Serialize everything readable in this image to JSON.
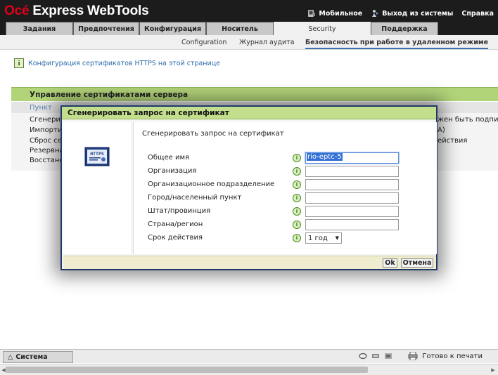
{
  "app": {
    "logo_brand": "Océ",
    "logo_rest": " Express WebTools",
    "links": [
      {
        "icon": "mobile-icon",
        "label": "Мобильное"
      },
      {
        "icon": "logout-icon",
        "label": "Выход из системы"
      },
      {
        "icon": "help-icon",
        "label": "Справка"
      }
    ]
  },
  "tabs": [
    {
      "label": "Задания"
    },
    {
      "label": "Предпочтения"
    },
    {
      "label": "Конфигурация"
    },
    {
      "label": "Носитель"
    },
    {
      "label": "Security",
      "active": true
    },
    {
      "label": "Поддержка"
    }
  ],
  "subnav": [
    {
      "label": "Configuration"
    },
    {
      "label": "Журнал аудита"
    },
    {
      "label": "Безопасность при работе в удаленном режиме",
      "active": true
    }
  ],
  "info": {
    "icon": "info-icon",
    "text": "Конфигурация сертификатов HTTPS на этой странице"
  },
  "section": {
    "title": "Управление сертификатами сервера",
    "column_header": "Пункт",
    "rows": [
      "Сгенерир",
      "Импорти",
      "Сброс сер",
      "Резервна",
      "Восстано"
    ],
    "right_fragments": [
      "жен быть подписа",
      "А)",
      "ействия"
    ]
  },
  "dialog": {
    "title": "Сгенерировать запрос на сертификат",
    "subtitle": "Сгенерировать запрос на сертификат",
    "icon": "https-certificate-icon",
    "icon_text": "HTTPS",
    "fields": [
      {
        "label": "Общее имя",
        "value": "rio-eptc-5"
      },
      {
        "label": "Организация",
        "value": ""
      },
      {
        "label": "Организационное подразделение",
        "value": ""
      },
      {
        "label": "Город/населенный пункт",
        "value": ""
      },
      {
        "label": "Штат/провинция",
        "value": ""
      },
      {
        "label": "Страна/регион",
        "value": ""
      }
    ],
    "validity": {
      "label": "Срок действия",
      "value": "1 год"
    },
    "ok": "Ok",
    "cancel": "Отмена"
  },
  "statusbar": {
    "system_tab": "Система",
    "status": "Готово к печати"
  }
}
